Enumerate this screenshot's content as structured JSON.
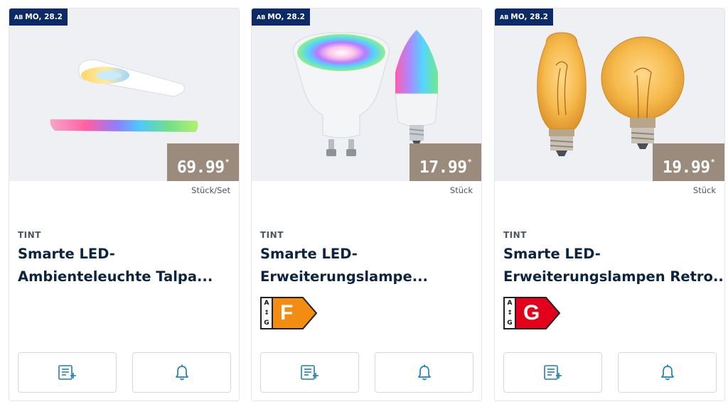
{
  "colors": {
    "badge_bg": "#0b2a66",
    "price_bg": "#9a8b7d",
    "title_text": "#0b2540",
    "icon_blue": "#1f7fb6",
    "energy_f": "#f28c13",
    "energy_g": "#e2001a"
  },
  "products": [
    {
      "badge_prefix": "AB",
      "badge_date": "MO, 28.2",
      "price": "69.99",
      "price_suffix": "*",
      "unit": "Stück/Set",
      "brand": "TINT",
      "title": "Smarte LED-\nAmbienteleuchte Talpa...",
      "energy_class": null,
      "image_icon": "ambient-light-bars",
      "actions": [
        "shopping-list-add-icon",
        "bell-icon"
      ]
    },
    {
      "badge_prefix": "AB",
      "badge_date": "MO, 28.2",
      "price": "17.99",
      "price_suffix": "*",
      "unit": "Stück",
      "brand": "TINT",
      "title": "Smarte LED-\nErweiterungslampe...",
      "energy_class": "F",
      "energy_scale_top": "A",
      "energy_scale_bottom": "G",
      "image_icon": "gu10-and-candle-bulbs",
      "actions": [
        "shopping-list-add-icon",
        "bell-icon"
      ]
    },
    {
      "badge_prefix": "AB",
      "badge_date": "MO, 28.2",
      "price": "19.99",
      "price_suffix": "*",
      "unit": "Stück",
      "brand": "TINT",
      "title": "Smarte LED-\nErweiterungslampen Retro...",
      "energy_class": "G",
      "energy_scale_top": "A",
      "energy_scale_bottom": "G",
      "image_icon": "retro-filament-bulbs",
      "actions": [
        "shopping-list-add-icon",
        "bell-icon"
      ]
    }
  ]
}
